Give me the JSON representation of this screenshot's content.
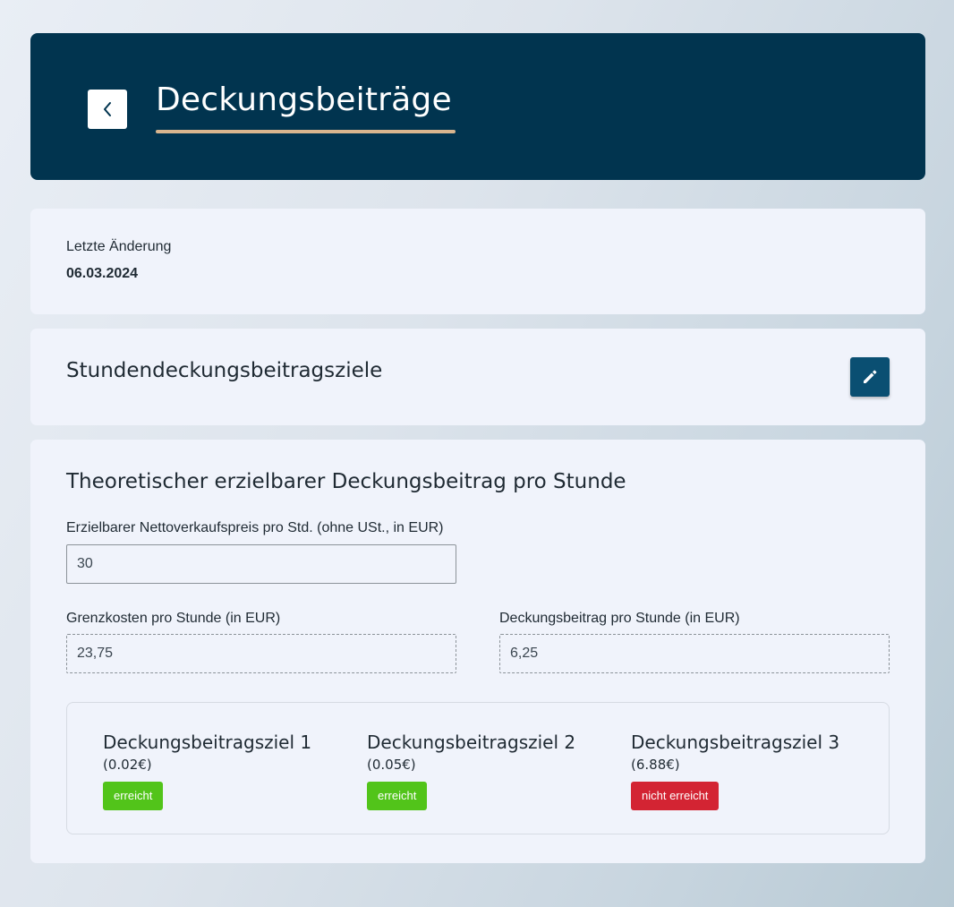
{
  "header": {
    "title": "Deckungsbeiträge",
    "back_icon": "chevron-left-icon",
    "accent_color": "#d9b58e",
    "background_color": "#01344f"
  },
  "last_change": {
    "label": "Letzte Änderung",
    "date": "06.03.2024"
  },
  "goals_section": {
    "title": "Stundendeckungsbeitragsziele",
    "edit_icon": "pencil-icon"
  },
  "calculation": {
    "title": "Theoretischer erzielbarer Deckungsbeitrag pro Stunde",
    "net_price": {
      "label": "Erzielbarer Nettoverkaufspreis pro Std. (ohne USt., in EUR)",
      "value": "30"
    },
    "marginal_cost": {
      "label": "Grenzkosten pro Stunde (in EUR)",
      "value": "23,75"
    },
    "contribution": {
      "label": "Deckungsbeitrag pro Stunde (in EUR)",
      "value": "6,25"
    },
    "goals": [
      {
        "title": "Deckungsbeitragsziel 1",
        "amount": "(0.02€)",
        "status": "erreicht",
        "status_color": "#52c41a"
      },
      {
        "title": "Deckungsbeitragsziel 2",
        "amount": "(0.05€)",
        "status": "erreicht",
        "status_color": "#52c41a"
      },
      {
        "title": "Deckungsbeitragsziel 3",
        "amount": "(6.88€)",
        "status": "nicht erreicht",
        "status_color": "#d32433"
      }
    ]
  }
}
